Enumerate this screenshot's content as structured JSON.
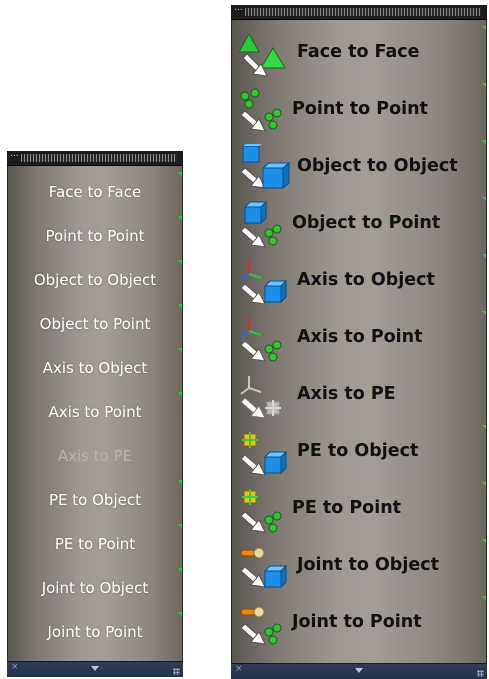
{
  "text_palette": {
    "title_dots": "...",
    "close_glyph": "×"
  },
  "text_only_palette": {
    "items": [
      {
        "label": "Face to Face",
        "enabled": true
      },
      {
        "label": "Point to Point",
        "enabled": true
      },
      {
        "label": "Object to Object",
        "enabled": true
      },
      {
        "label": "Object to Point",
        "enabled": true
      },
      {
        "label": "Axis to Object",
        "enabled": true
      },
      {
        "label": "Axis to Point",
        "enabled": true
      },
      {
        "label": "Axis to PE",
        "enabled": false
      },
      {
        "label": "PE to Object",
        "enabled": true
      },
      {
        "label": "PE to Point",
        "enabled": true
      },
      {
        "label": "Joint to Object",
        "enabled": true
      },
      {
        "label": "Joint to Point",
        "enabled": true
      }
    ]
  },
  "icon_palette": {
    "items": [
      {
        "label": "Face to Face",
        "icon": "face-to-face-icon",
        "enabled": true
      },
      {
        "label": "Point to Point",
        "icon": "point-to-point-icon",
        "enabled": true
      },
      {
        "label": "Object to Object",
        "icon": "object-to-object-icon",
        "enabled": true
      },
      {
        "label": "Object to Point",
        "icon": "object-to-point-icon",
        "enabled": true
      },
      {
        "label": "Axis to Object",
        "icon": "axis-to-object-icon",
        "enabled": true
      },
      {
        "label": "Axis to Point",
        "icon": "axis-to-point-icon",
        "enabled": true
      },
      {
        "label": "Axis to PE",
        "icon": "axis-to-pe-icon",
        "enabled": false
      },
      {
        "label": "PE to Object",
        "icon": "pe-to-object-icon",
        "enabled": true
      },
      {
        "label": "PE to Point",
        "icon": "pe-to-point-icon",
        "enabled": true
      },
      {
        "label": "Joint to Object",
        "icon": "joint-to-object-icon",
        "enabled": true
      },
      {
        "label": "Joint to Point",
        "icon": "joint-to-point-icon",
        "enabled": true
      }
    ]
  },
  "colors": {
    "panel_mid": "#a39d95",
    "panel_edge": "#5b5550",
    "titlebar": "#1c1c1e",
    "bottombar": "#2f3e54",
    "green_tick": "#2fd12f",
    "arrow": "#ffffff"
  }
}
